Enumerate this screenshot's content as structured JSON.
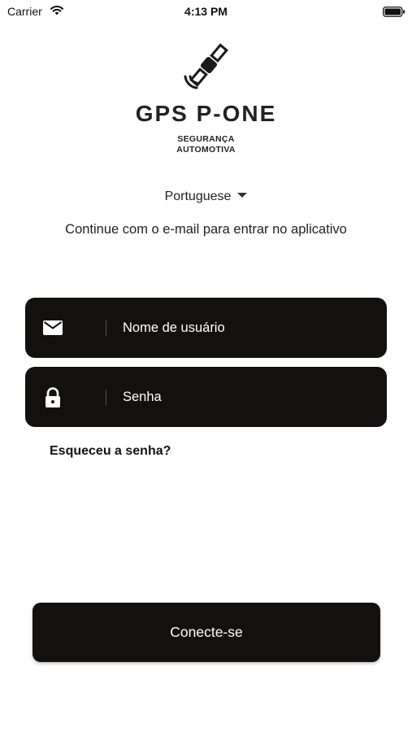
{
  "status_bar": {
    "carrier": "Carrier",
    "time": "4:13 PM",
    "wifi_icon": "wifi-icon",
    "battery_icon": "battery-icon"
  },
  "brand": {
    "logo_icon": "satellite-icon",
    "name": "GPS P-ONE",
    "tagline_line1": "SEGURANÇA",
    "tagline_line2": "AUTOMOTIVA"
  },
  "language": {
    "selected": "Portuguese"
  },
  "subtitle": "Continue com o e-mail para entrar no aplicativo",
  "form": {
    "username_placeholder": "Nome de usuário",
    "username_icon": "mail-icon",
    "password_placeholder": "Senha",
    "password_icon": "lock-icon",
    "forgot_label": "Esqueceu a senha?",
    "submit_label": "Conecte-se"
  },
  "colors": {
    "field_background": "#131110",
    "text_primary": "#111111",
    "background": "#ffffff"
  }
}
